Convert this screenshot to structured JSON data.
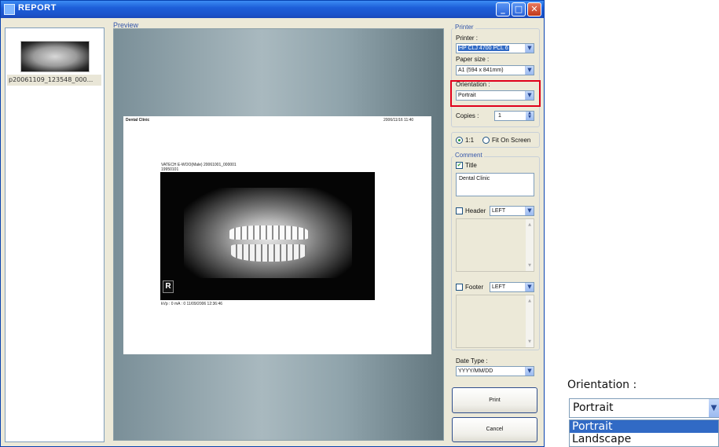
{
  "window": {
    "title": "REPORT",
    "controls": [
      "_",
      "□",
      "✕"
    ]
  },
  "thumbnails": [
    {
      "caption": "p20061109_123548_000..."
    }
  ],
  "preview": {
    "label": "Preview",
    "page": {
      "title": "Dental Clinic",
      "datetime": "2006/11/16  11:40",
      "patient": "VATECH E-WOO(Male) 20061001_000001",
      "dob": "19950101",
      "footer": "kVp : 0     mA : 0     11/09/2006 12:36:46",
      "marker": "R"
    }
  },
  "printer_group": {
    "title": "Printer",
    "printer_label": "Printer :",
    "printer_value": "HP CLJ 4700 PCL 6",
    "paper_label": "Paper size :",
    "paper_value": "A1 (594 x 841mm)",
    "orientation_label": "Orientation :",
    "orientation_value": "Portrait",
    "copies_label": "Copies :",
    "copies_value": "1"
  },
  "scale": {
    "one_to_one": "1:1",
    "fit": "Fit On Screen",
    "selected": "1:1"
  },
  "comment_group": {
    "title": "Comment",
    "title_check_label": "Title",
    "title_checked": true,
    "title_text": "Dental Clinic",
    "header_label": "Header",
    "header_checked": false,
    "header_align": "LEFT",
    "footer_label": "Footer",
    "footer_checked": false,
    "footer_align": "LEFT"
  },
  "date_type": {
    "label": "Date Type :",
    "value": "YYYY/MM/DD"
  },
  "buttons": {
    "print": "Print",
    "cancel": "Cancel"
  },
  "zoom_inset": {
    "label": "Orientation :",
    "value": "Portrait",
    "options": [
      "Portrait",
      "Landscape"
    ],
    "highlighted": "Portrait"
  }
}
